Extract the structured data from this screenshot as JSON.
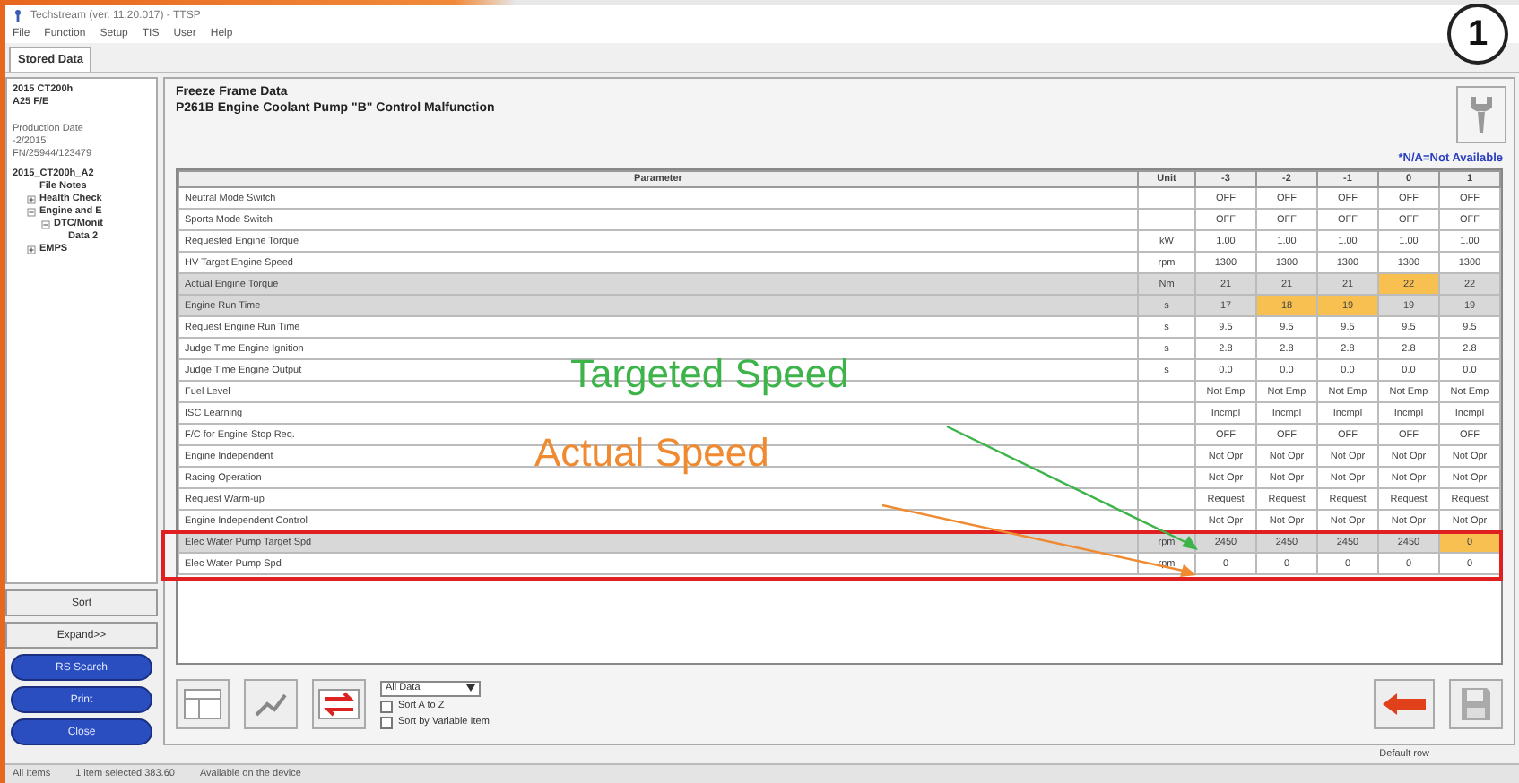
{
  "window": {
    "title": "Techstream (ver. 11.20.017) - TTSP"
  },
  "menu": [
    "File",
    "Function",
    "Setup",
    "TIS",
    "User",
    "Help"
  ],
  "tabs": [
    {
      "label": "Stored Data",
      "selected": true
    }
  ],
  "sidebar": {
    "vehicle": [
      "2015 CT200h",
      "A25 F/E"
    ],
    "production_label": "Production Date",
    "production_value": "-2/2015",
    "vin": "FN/25944/123479",
    "tree": [
      {
        "label": "2015_CT200h_A2",
        "kind": "root",
        "children": [
          {
            "label": "File Notes",
            "kind": "leaf"
          },
          {
            "label": "Health Check",
            "kind": "folder",
            "expanded": false
          },
          {
            "label": "Engine and E",
            "kind": "folder",
            "expanded": true,
            "children": [
              {
                "label": "DTC/Monit",
                "kind": "folder",
                "expanded": true,
                "children": [
                  {
                    "label": "Data 2",
                    "kind": "leaf"
                  }
                ]
              }
            ]
          },
          {
            "label": "EMPS",
            "kind": "folder",
            "expanded": false
          }
        ]
      }
    ],
    "buttons": [
      {
        "label": "Sort",
        "kind": "plain"
      },
      {
        "label": "Expand>>",
        "kind": "plain"
      },
      {
        "label": "RS Search",
        "kind": "blue"
      },
      {
        "label": "Print",
        "kind": "blue"
      },
      {
        "label": "Close",
        "kind": "blue"
      }
    ]
  },
  "header": {
    "title": "Freeze Frame Data",
    "subtitle": "P261B Engine Coolant Pump \"B\" Control Malfunction",
    "note": "*N/A=Not Available"
  },
  "table": {
    "columns": [
      "Parameter",
      "Unit",
      "-3",
      "-2",
      "-1",
      "0",
      "1"
    ],
    "rows": [
      {
        "parameter": "Neutral Mode Switch",
        "unit": "",
        "selected": false,
        "values": [
          {
            "text": "OFF",
            "highlighted": false
          },
          {
            "text": "OFF",
            "highlighted": false
          },
          {
            "text": "OFF",
            "highlighted": false
          },
          {
            "text": "OFF",
            "highlighted": false
          },
          {
            "text": "OFF",
            "highlighted": false
          }
        ]
      },
      {
        "parameter": "Sports Mode Switch",
        "unit": "",
        "selected": false,
        "values": [
          {
            "text": "OFF",
            "highlighted": false
          },
          {
            "text": "OFF",
            "highlighted": false
          },
          {
            "text": "OFF",
            "highlighted": false
          },
          {
            "text": "OFF",
            "highlighted": false
          },
          {
            "text": "OFF",
            "highlighted": false
          }
        ]
      },
      {
        "parameter": "Requested Engine Torque",
        "unit": "kW",
        "selected": false,
        "values": [
          {
            "text": "1.00",
            "highlighted": false
          },
          {
            "text": "1.00",
            "highlighted": false
          },
          {
            "text": "1.00",
            "highlighted": false
          },
          {
            "text": "1.00",
            "highlighted": false
          },
          {
            "text": "1.00",
            "highlighted": false
          }
        ]
      },
      {
        "parameter": "HV Target Engine Speed",
        "unit": "rpm",
        "selected": false,
        "values": [
          {
            "text": "1300",
            "highlighted": false
          },
          {
            "text": "1300",
            "highlighted": false
          },
          {
            "text": "1300",
            "highlighted": false
          },
          {
            "text": "1300",
            "highlighted": false
          },
          {
            "text": "1300",
            "highlighted": false
          }
        ]
      },
      {
        "parameter": "Actual Engine Torque",
        "unit": "Nm",
        "selected": true,
        "values": [
          {
            "text": "21",
            "highlighted": false
          },
          {
            "text": "21",
            "highlighted": false
          },
          {
            "text": "21",
            "highlighted": false
          },
          {
            "text": "22",
            "highlighted": true
          },
          {
            "text": "22",
            "highlighted": false
          }
        ]
      },
      {
        "parameter": "Engine Run Time",
        "unit": "s",
        "selected": true,
        "values": [
          {
            "text": "17",
            "highlighted": false
          },
          {
            "text": "18",
            "highlighted": true
          },
          {
            "text": "19",
            "highlighted": true
          },
          {
            "text": "19",
            "highlighted": false
          },
          {
            "text": "19",
            "highlighted": false
          }
        ]
      },
      {
        "parameter": "Request Engine Run Time",
        "unit": "s",
        "selected": false,
        "values": [
          {
            "text": "9.5",
            "highlighted": false
          },
          {
            "text": "9.5",
            "highlighted": false
          },
          {
            "text": "9.5",
            "highlighted": false
          },
          {
            "text": "9.5",
            "highlighted": false
          },
          {
            "text": "9.5",
            "highlighted": false
          }
        ]
      },
      {
        "parameter": "Judge Time Engine Ignition",
        "unit": "s",
        "selected": false,
        "values": [
          {
            "text": "2.8",
            "highlighted": false
          },
          {
            "text": "2.8",
            "highlighted": false
          },
          {
            "text": "2.8",
            "highlighted": false
          },
          {
            "text": "2.8",
            "highlighted": false
          },
          {
            "text": "2.8",
            "highlighted": false
          }
        ]
      },
      {
        "parameter": "Judge Time Engine Output",
        "unit": "s",
        "selected": false,
        "values": [
          {
            "text": "0.0",
            "highlighted": false
          },
          {
            "text": "0.0",
            "highlighted": false
          },
          {
            "text": "0.0",
            "highlighted": false
          },
          {
            "text": "0.0",
            "highlighted": false
          },
          {
            "text": "0.0",
            "highlighted": false
          }
        ]
      },
      {
        "parameter": "Fuel Level",
        "unit": "",
        "selected": false,
        "values": [
          {
            "text": "Not Emp",
            "highlighted": false
          },
          {
            "text": "Not Emp",
            "highlighted": false
          },
          {
            "text": "Not Emp",
            "highlighted": false
          },
          {
            "text": "Not Emp",
            "highlighted": false
          },
          {
            "text": "Not Emp",
            "highlighted": false
          }
        ]
      },
      {
        "parameter": "ISC Learning",
        "unit": "",
        "selected": false,
        "values": [
          {
            "text": "Incmpl",
            "highlighted": false
          },
          {
            "text": "Incmpl",
            "highlighted": false
          },
          {
            "text": "Incmpl",
            "highlighted": false
          },
          {
            "text": "Incmpl",
            "highlighted": false
          },
          {
            "text": "Incmpl",
            "highlighted": false
          }
        ]
      },
      {
        "parameter": "F/C for Engine Stop Req.",
        "unit": "",
        "selected": false,
        "values": [
          {
            "text": "OFF",
            "highlighted": false
          },
          {
            "text": "OFF",
            "highlighted": false
          },
          {
            "text": "OFF",
            "highlighted": false
          },
          {
            "text": "OFF",
            "highlighted": false
          },
          {
            "text": "OFF",
            "highlighted": false
          }
        ]
      },
      {
        "parameter": "Engine Independent",
        "unit": "",
        "selected": false,
        "values": [
          {
            "text": "Not Opr",
            "highlighted": false
          },
          {
            "text": "Not Opr",
            "highlighted": false
          },
          {
            "text": "Not Opr",
            "highlighted": false
          },
          {
            "text": "Not Opr",
            "highlighted": false
          },
          {
            "text": "Not Opr",
            "highlighted": false
          }
        ]
      },
      {
        "parameter": "Racing Operation",
        "unit": "",
        "selected": false,
        "values": [
          {
            "text": "Not Opr",
            "highlighted": false
          },
          {
            "text": "Not Opr",
            "highlighted": false
          },
          {
            "text": "Not Opr",
            "highlighted": false
          },
          {
            "text": "Not Opr",
            "highlighted": false
          },
          {
            "text": "Not Opr",
            "highlighted": false
          }
        ]
      },
      {
        "parameter": "Request Warm-up",
        "unit": "",
        "selected": false,
        "values": [
          {
            "text": "Request",
            "highlighted": false
          },
          {
            "text": "Request",
            "highlighted": false
          },
          {
            "text": "Request",
            "highlighted": false
          },
          {
            "text": "Request",
            "highlighted": false
          },
          {
            "text": "Request",
            "highlighted": false
          }
        ]
      },
      {
        "parameter": "Engine Independent Control",
        "unit": "",
        "selected": false,
        "values": [
          {
            "text": "Not Opr",
            "highlighted": false
          },
          {
            "text": "Not Opr",
            "highlighted": false
          },
          {
            "text": "Not Opr",
            "highlighted": false
          },
          {
            "text": "Not Opr",
            "highlighted": false
          },
          {
            "text": "Not Opr",
            "highlighted": false
          }
        ]
      },
      {
        "parameter": "Elec Water Pump Target Spd",
        "unit": "rpm",
        "selected": true,
        "values": [
          {
            "text": "2450",
            "highlighted": false
          },
          {
            "text": "2450",
            "highlighted": false
          },
          {
            "text": "2450",
            "highlighted": false
          },
          {
            "text": "2450",
            "highlighted": false
          },
          {
            "text": "0",
            "highlighted": true
          }
        ]
      },
      {
        "parameter": "Elec Water Pump Spd",
        "unit": "rpm",
        "selected": false,
        "values": [
          {
            "text": "0",
            "highlighted": false
          },
          {
            "text": "0",
            "highlighted": false
          },
          {
            "text": "0",
            "highlighted": false
          },
          {
            "text": "0",
            "highlighted": false
          },
          {
            "text": "0",
            "highlighted": false
          }
        ]
      }
    ]
  },
  "toolbar": {
    "filter": "All Data",
    "checks": [
      {
        "label": "Sort A to Z",
        "checked": false
      },
      {
        "label": "Sort by Variable Item",
        "checked": false
      }
    ],
    "default_row": "Default row"
  },
  "status_bar": [
    "All Items",
    "1 item selected  383.60",
    "Available on the device"
  ],
  "annotations": [
    {
      "text": "Targeted Speed",
      "color": "#3cb44a"
    },
    {
      "text": "Actual Speed",
      "color": "#f08a30"
    }
  ],
  "marker": "1"
}
